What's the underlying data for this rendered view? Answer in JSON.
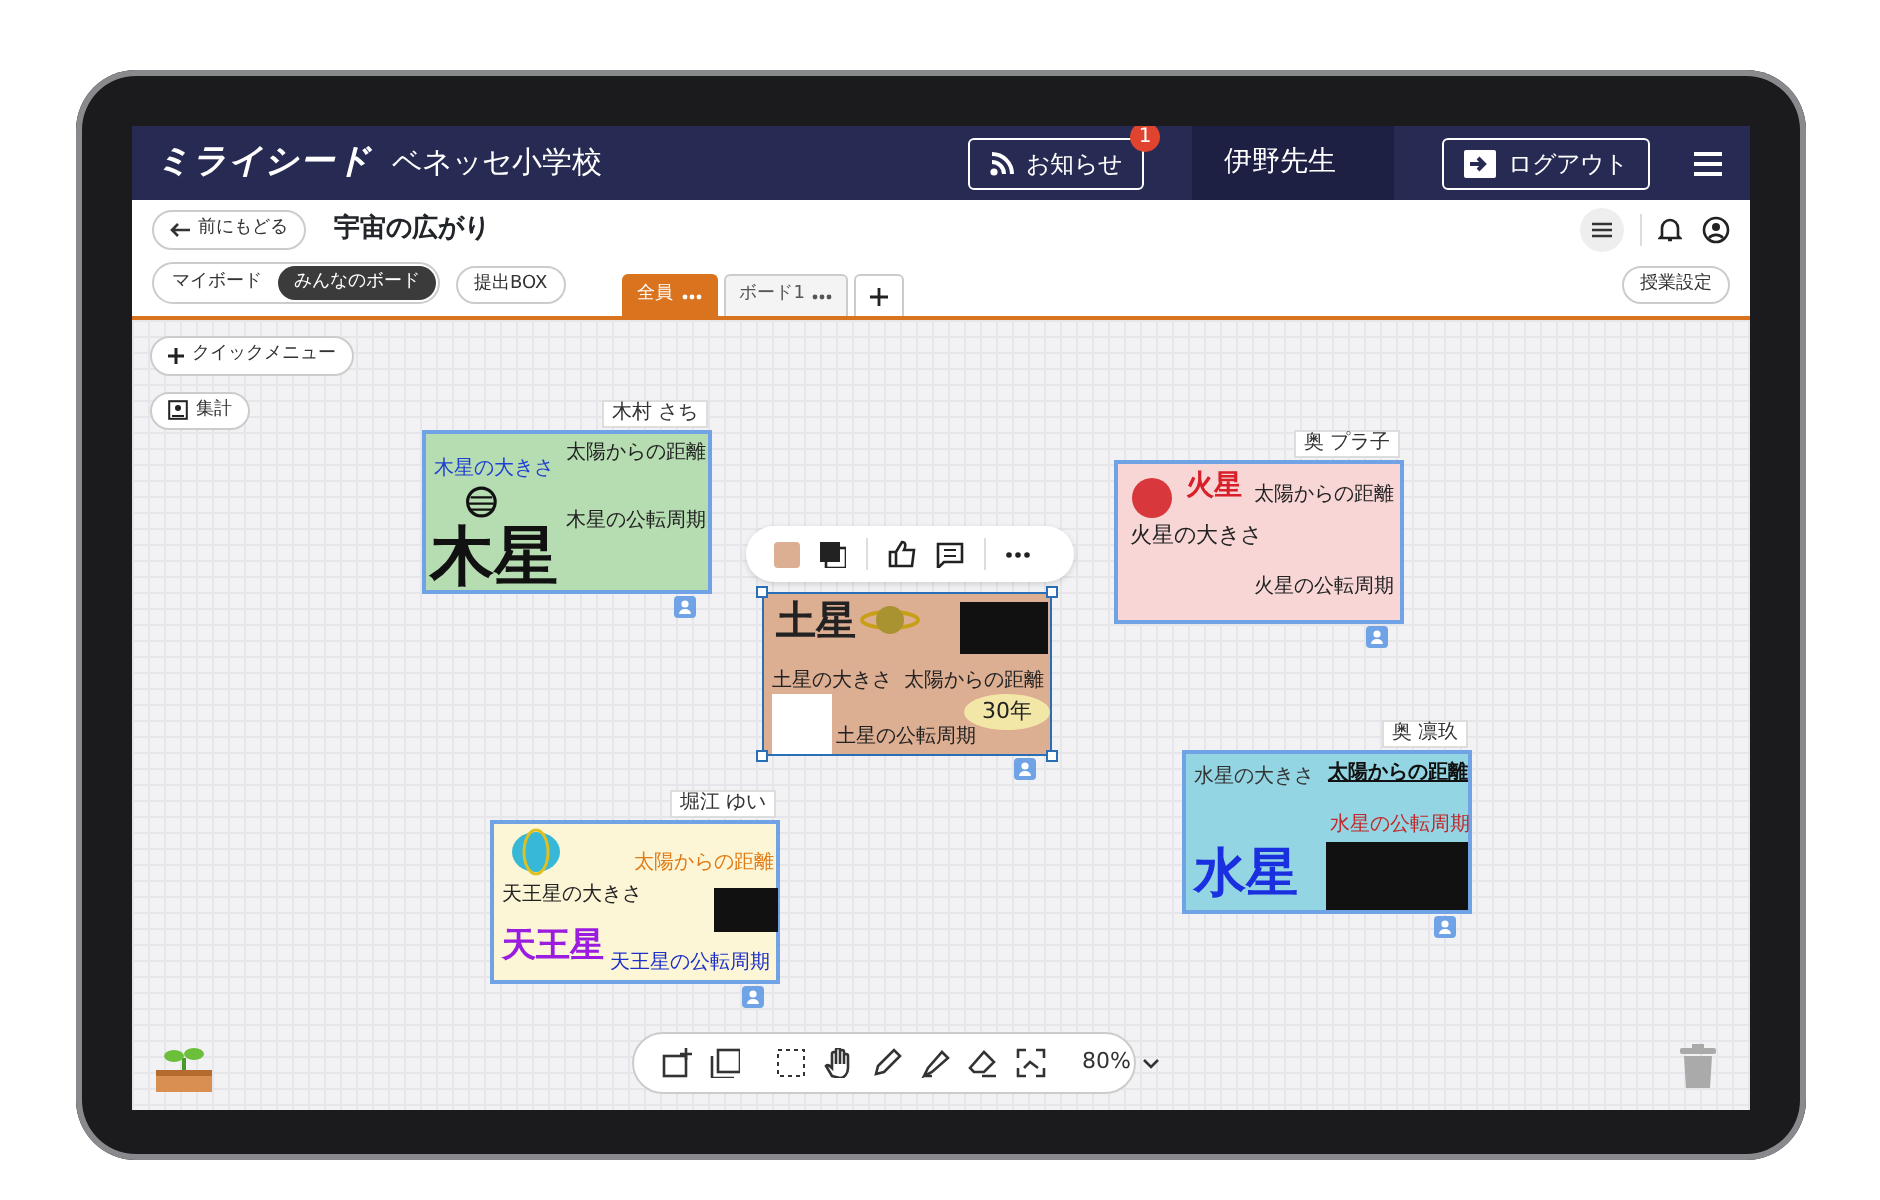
{
  "header": {
    "logo": "ミライシード",
    "school": "ベネッセ小学校",
    "notice": {
      "label": "お知らせ",
      "badge": "1"
    },
    "teacher": "伊野先生",
    "logout": "ログアウト"
  },
  "subheader": {
    "back": "前にもどる",
    "title": "宇宙の広がり"
  },
  "view_tabs": [
    {
      "label": "マイボード",
      "selected": false
    },
    {
      "label": "みんなのボード",
      "selected": true
    }
  ],
  "submit_box": "提出BOX",
  "board_tabs": [
    {
      "label": "全員",
      "selected": true
    },
    {
      "label": "ボード1",
      "selected": false
    }
  ],
  "class_settings": "授業設定",
  "canvas_buttons": [
    "クイックメニュー",
    "集計"
  ],
  "cards": [
    {
      "author": "木村 さち",
      "color": "#b6dcb2",
      "selected": false,
      "texts": [
        {
          "text": "木星の大きさ",
          "color": "#1f3fd0"
        },
        {
          "text": "太陽からの距離",
          "color": "#222222"
        },
        {
          "text": "木星",
          "color": "#111111"
        },
        {
          "text": "木星の公転周期",
          "color": "#222222"
        }
      ]
    },
    {
      "color": "#dcae92",
      "selected": true,
      "texts": [
        {
          "text": "土星",
          "color": "#222222"
        },
        {
          "text": "土星の大きさ",
          "color": "#222222"
        },
        {
          "text": "太陽からの距離",
          "color": "#222222"
        },
        {
          "text": "30年",
          "color": "#222222"
        },
        {
          "text": "土星の公転周期",
          "color": "#222222"
        }
      ]
    },
    {
      "author": "奥 プラ子",
      "color": "#f8d6d6",
      "selected": false,
      "texts": [
        {
          "text": "火星",
          "color": "#d8202a"
        },
        {
          "text": "太陽からの距離",
          "color": "#222222"
        },
        {
          "text": "火星の大きさ",
          "color": "#222222"
        },
        {
          "text": "火星の公転周期",
          "color": "#222222"
        }
      ]
    },
    {
      "author": "奥 凛玖",
      "color": "#93d5e2",
      "selected": false,
      "texts": [
        {
          "text": "水星の大きさ",
          "color": "#333333"
        },
        {
          "text": "太陽からの距離",
          "color": "#111111"
        },
        {
          "text": "水星の公転周期",
          "color": "#c0282a"
        },
        {
          "text": "水星",
          "color": "#1a2fe0"
        }
      ]
    },
    {
      "author": "堀江 ゆい",
      "color": "#fcf6d6",
      "selected": false,
      "texts": [
        {
          "text": "太陽からの距離",
          "color": "#e07a14"
        },
        {
          "text": "天王星の大きさ",
          "color": "#222222"
        },
        {
          "text": "天王星",
          "color": "#9a1ce0"
        },
        {
          "text": "天王星の公転周期",
          "color": "#1d2fc8"
        }
      ]
    }
  ],
  "zoom": "80%"
}
